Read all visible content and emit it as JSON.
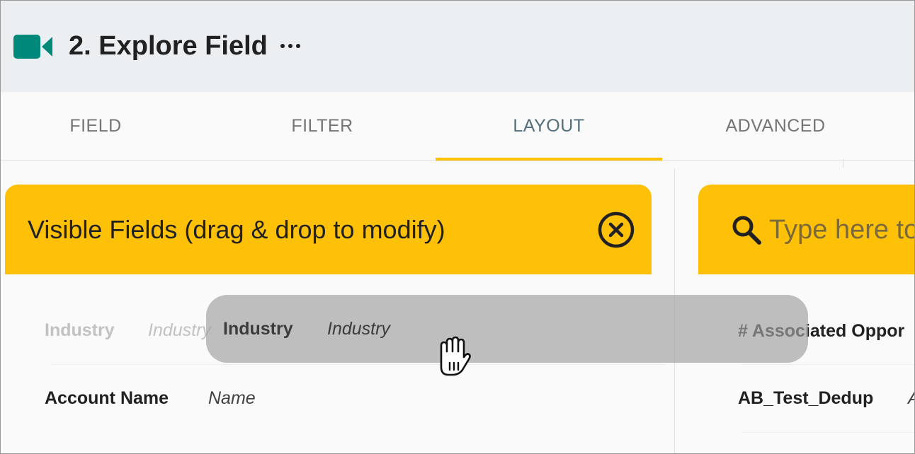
{
  "header": {
    "title": "2. Explore Field",
    "app_icon": "video-camera-icon",
    "menu_icon": "more-horizontal-icon",
    "accent_color": "#00897b"
  },
  "tabs": [
    {
      "label": "FIELD",
      "active": false
    },
    {
      "label": "FILTER",
      "active": false
    },
    {
      "label": "LAYOUT",
      "active": true
    },
    {
      "label": "ADVANCED",
      "active": false
    }
  ],
  "colors": {
    "panel_header": "#ffc107",
    "active_tab_indicator": "#ffc400",
    "active_tab_text": "#546e7a"
  },
  "visible_fields": {
    "title": "Visible Fields (drag & drop to modify)",
    "close_icon": "close-circle-icon",
    "rows": [
      {
        "name": "Industry",
        "alias": "Industry",
        "state": "drag-placeholder"
      },
      {
        "name": "Account Name",
        "alias": "Name",
        "state": "normal"
      }
    ]
  },
  "drag_item": {
    "name": "Industry",
    "alias": "Industry",
    "cursor_icon": "grab-hand-icon"
  },
  "available_fields": {
    "search_placeholder": "Type here to",
    "search_icon": "search-icon",
    "rows": [
      {
        "name": "# Associated Oppor"
      },
      {
        "name": "AB_Test_Dedup",
        "alias": "A"
      }
    ]
  }
}
